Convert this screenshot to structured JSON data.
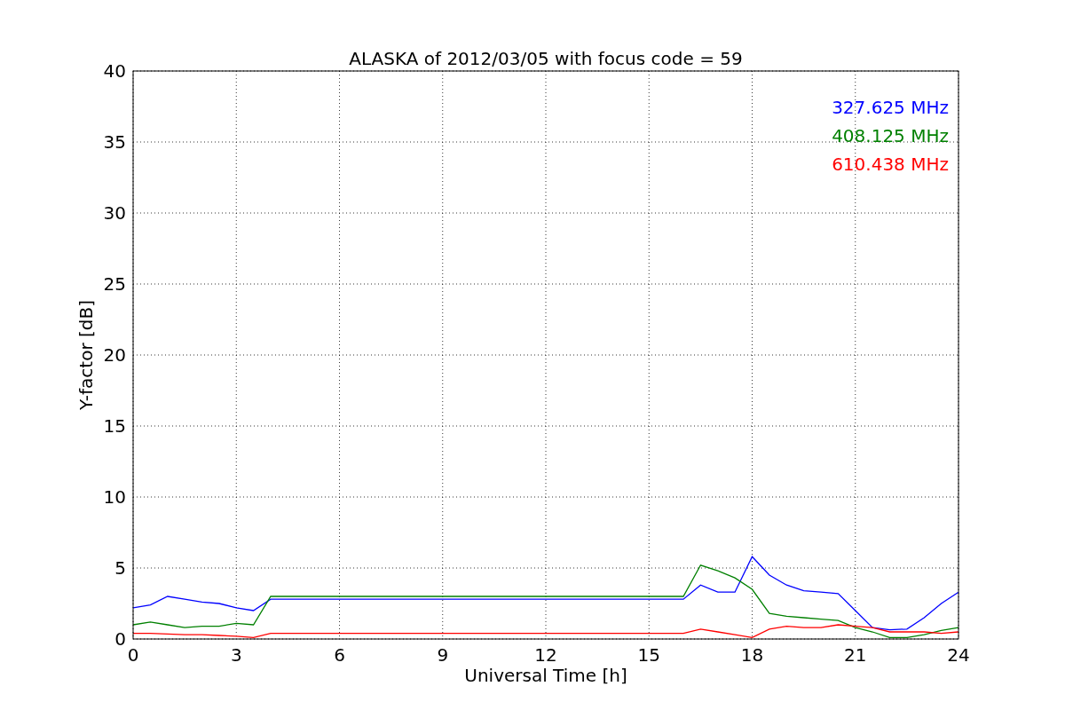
{
  "chart": {
    "chart_data": {
      "type": "line",
      "title": "ALASKA of 2012/03/05 with focus code = 59",
      "xlabel": "Universal Time [h]",
      "ylabel": "Y-factor [dB]",
      "x": [
        0,
        0.5,
        1,
        1.5,
        2,
        2.5,
        3,
        3.5,
        4,
        4.5,
        5,
        5.5,
        6,
        6.5,
        7,
        7.5,
        8,
        8.5,
        9,
        9.5,
        10,
        10.5,
        11,
        11.5,
        12,
        12.5,
        13,
        13.5,
        14,
        14.5,
        15,
        15.5,
        16,
        16.5,
        17,
        17.5,
        18,
        18.5,
        19,
        19.5,
        20,
        20.5,
        21,
        21.5,
        22,
        22.5,
        23,
        23.5,
        24
      ],
      "series": [
        {
          "name": "327.625 MHz",
          "color": "#0000ff",
          "values": [
            2.2,
            2.4,
            3.0,
            2.8,
            2.6,
            2.5,
            2.2,
            2.0,
            2.8,
            2.8,
            2.8,
            2.8,
            2.8,
            2.8,
            2.8,
            2.8,
            2.8,
            2.8,
            2.8,
            2.8,
            2.8,
            2.8,
            2.8,
            2.8,
            2.8,
            2.8,
            2.8,
            2.8,
            2.8,
            2.8,
            2.8,
            2.8,
            2.8,
            3.8,
            3.3,
            3.3,
            5.8,
            4.5,
            3.8,
            3.4,
            3.3,
            3.2,
            2.0,
            0.8,
            0.65,
            0.7,
            1.5,
            2.5,
            3.3
          ]
        },
        {
          "name": "408.125 MHz",
          "color": "#008000",
          "values": [
            1.0,
            1.2,
            1.0,
            0.8,
            0.9,
            0.9,
            1.1,
            1.0,
            3.0,
            3.0,
            3.0,
            3.0,
            3.0,
            3.0,
            3.0,
            3.0,
            3.0,
            3.0,
            3.0,
            3.0,
            3.0,
            3.0,
            3.0,
            3.0,
            3.0,
            3.0,
            3.0,
            3.0,
            3.0,
            3.0,
            3.0,
            3.0,
            3.0,
            5.2,
            4.8,
            4.3,
            3.5,
            1.8,
            1.6,
            1.5,
            1.4,
            1.3,
            0.8,
            0.5,
            0.1,
            0.1,
            0.3,
            0.6,
            0.8
          ]
        },
        {
          "name": "610.438 MHz",
          "color": "#ff0000",
          "values": [
            0.4,
            0.4,
            0.35,
            0.3,
            0.3,
            0.25,
            0.2,
            0.1,
            0.4,
            0.4,
            0.4,
            0.4,
            0.4,
            0.4,
            0.4,
            0.4,
            0.4,
            0.4,
            0.4,
            0.4,
            0.4,
            0.4,
            0.4,
            0.4,
            0.4,
            0.4,
            0.4,
            0.4,
            0.4,
            0.4,
            0.4,
            0.4,
            0.4,
            0.7,
            0.5,
            0.3,
            0.1,
            0.7,
            0.9,
            0.8,
            0.8,
            1.0,
            0.9,
            0.8,
            0.5,
            0.5,
            0.5,
            0.4,
            0.5
          ]
        }
      ],
      "xlim": [
        0,
        24
      ],
      "ylim": [
        0,
        40
      ],
      "xticks": [
        0,
        3,
        6,
        9,
        12,
        15,
        18,
        21,
        24
      ],
      "yticks": [
        0,
        5,
        10,
        15,
        20,
        25,
        30,
        35,
        40
      ],
      "grid": true
    }
  }
}
